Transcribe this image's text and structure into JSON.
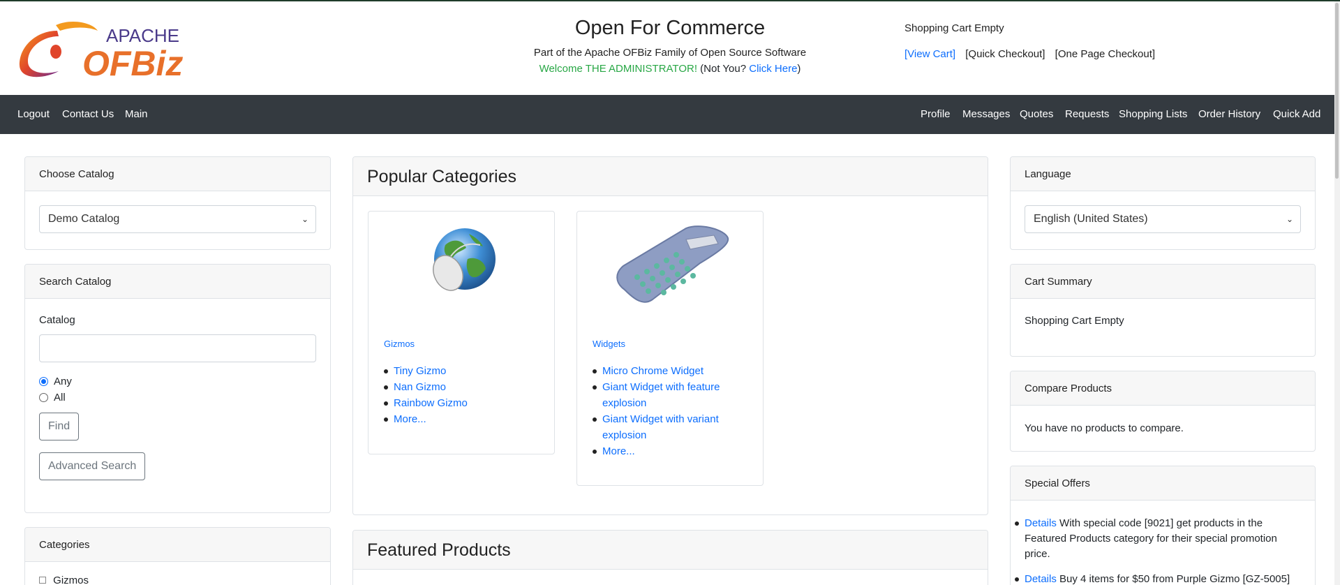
{
  "header": {
    "logo_top": "APACHE",
    "logo_main": "OFBiz",
    "title": "Open For Commerce",
    "subtitle": "Part of the Apache OFBiz Family of Open Source Software",
    "welcome": "Welcome THE ADMINISTRATOR!",
    "not_you": "(Not You?",
    "click_here": "Click Here",
    "close_paren": ")",
    "cart_status": "Shopping Cart Empty",
    "view_cart": "[View Cart]",
    "quick_checkout": "[Quick Checkout]",
    "one_page_checkout": "[One Page Checkout]"
  },
  "nav": {
    "left": [
      "Logout",
      "Contact Us",
      "Main"
    ],
    "right": [
      "Profile",
      "Messages",
      "Quotes",
      "Requests",
      "Shopping Lists",
      "Order History",
      "Quick Add"
    ]
  },
  "left": {
    "choose_catalog": {
      "title": "Choose Catalog",
      "selected": "Demo Catalog"
    },
    "search_catalog": {
      "title": "Search Catalog",
      "field_label": "Catalog",
      "field_value": "",
      "radio_any": "Any",
      "radio_all": "All",
      "find": "Find",
      "advanced": "Advanced Search"
    },
    "categories": {
      "title": "Categories",
      "first_item": "Gizmos"
    }
  },
  "main": {
    "popular": {
      "title": "Popular Categories",
      "cards": [
        {
          "name": "Gizmos",
          "icon": "globe-mouse-icon",
          "items": [
            "Tiny Gizmo",
            "Nan Gizmo",
            "Rainbow Gizmo",
            "More..."
          ]
        },
        {
          "name": "Widgets",
          "icon": "calculator-icon",
          "items": [
            "Micro Chrome Widget",
            "Giant Widget with feature explosion",
            "Giant Widget with variant explosion",
            "More..."
          ]
        }
      ]
    },
    "featured": {
      "title": "Featured Products"
    }
  },
  "right": {
    "language": {
      "title": "Language",
      "selected": "English (United States)"
    },
    "cart_summary": {
      "title": "Cart Summary",
      "text": "Shopping Cart Empty"
    },
    "compare": {
      "title": "Compare Products",
      "text": "You have no products to compare."
    },
    "offers": {
      "title": "Special Offers",
      "items": [
        {
          "link": "Details",
          "text": "With special code [9021] get products in the Featured Products category for their special promotion price."
        },
        {
          "link": "Details",
          "text": "Buy 4 items for $50 from Purple Gizmo [GZ-5005]"
        }
      ]
    }
  }
}
